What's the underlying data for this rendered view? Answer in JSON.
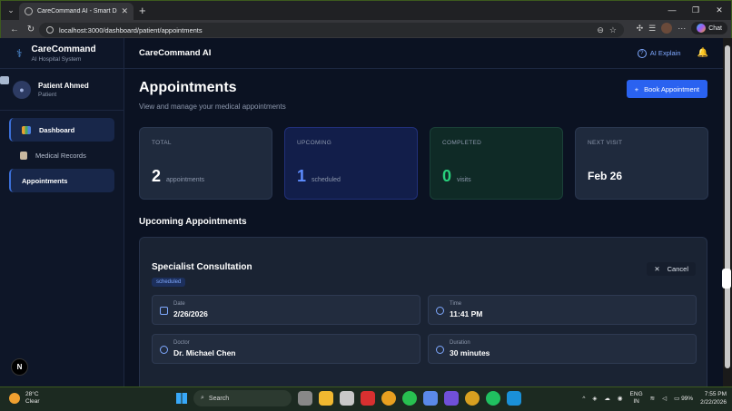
{
  "browser": {
    "tab_title": "CareCommand AI - Smart Digital H",
    "url": "localhost:3000/dashboard/patient/appointments",
    "chat_label": "Chat"
  },
  "sidebar": {
    "brand_name": "CareCommand",
    "brand_sub": "AI Hospital System",
    "user_name": "Patient Ahmed",
    "user_role": "Patient",
    "items": [
      {
        "label": "Dashboard"
      },
      {
        "label": "Medical Records"
      },
      {
        "label": "Appointments"
      }
    ],
    "bottom_badge": "N"
  },
  "topbar": {
    "title": "CareCommand AI",
    "ai_explain": "AI Explain"
  },
  "page": {
    "title": "Appointments",
    "subtitle": "View and manage your medical appointments",
    "book_button": "Book Appointment"
  },
  "stats": {
    "total": {
      "label": "TOTAL",
      "value": "2",
      "unit": "appointments"
    },
    "upcoming": {
      "label": "UPCOMING",
      "value": "1",
      "unit": "scheduled"
    },
    "completed": {
      "label": "COMPLETED",
      "value": "0",
      "unit": "visits"
    },
    "next_visit": {
      "label": "NEXT VISIT",
      "value": "Feb 26"
    }
  },
  "upcoming": {
    "section_title": "Upcoming Appointments",
    "appointment": {
      "title": "Specialist Consultation",
      "status": "scheduled",
      "cancel_label": "Cancel",
      "date_label": "Date",
      "date_value": "2/26/2026",
      "time_label": "Time",
      "time_value": "11:41 PM",
      "doctor_label": "Doctor",
      "doctor_value": "Dr. Michael Chen",
      "duration_label": "Duration",
      "duration_value": "30 minutes"
    }
  },
  "taskbar": {
    "temp": "28°C",
    "weather": "Clear",
    "search_placeholder": "Search",
    "lang1": "ENG",
    "lang2": "IN",
    "battery": "99%",
    "time": "7:55 PM",
    "date": "2/22/2026"
  }
}
